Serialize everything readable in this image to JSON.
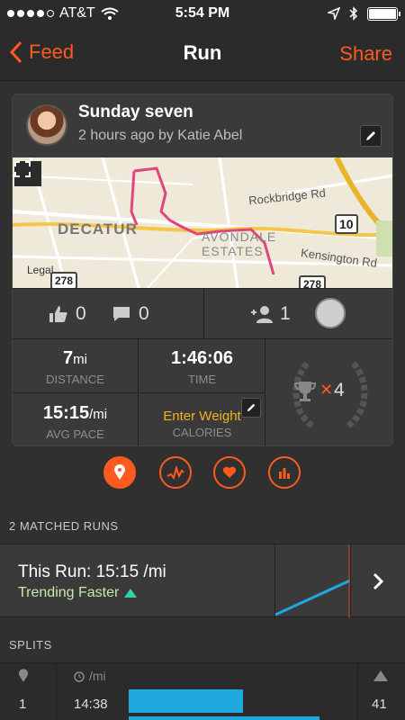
{
  "status": {
    "carrier": "AT&T",
    "time": "5:54 PM",
    "signal_bars": 4,
    "signal_total": 5
  },
  "nav": {
    "back_label": "Feed",
    "title": "Run",
    "share_label": "Share"
  },
  "activity": {
    "title": "Sunday seven",
    "subtitle": "2 hours ago by Katie Abel",
    "map_labels": {
      "decatur": "DECATUR",
      "avondale": "AVONDALE",
      "estates": "ESTATES",
      "rockbridge": "Rockbridge Rd",
      "kensington": "Kensington Rd",
      "legal": "Legal",
      "route_278a": "278",
      "route_278b": "278",
      "route_10": "10"
    }
  },
  "social": {
    "kudos_count": "0",
    "comments_count": "0",
    "athletes_count": "1"
  },
  "stats": {
    "distance_value": "7",
    "distance_unit": "mi",
    "distance_label": "DISTANCE",
    "time_value": "1:46:06",
    "time_label": "TIME",
    "pace_value": "15:15",
    "pace_unit": "/mi",
    "pace_label": "AVG PACE",
    "weight_prompt": "Enter Weight",
    "calories_label": "CALORIES",
    "achievements_count": "4"
  },
  "matched": {
    "section_label": "2 MATCHED RUNS",
    "title": "This Run: 15:15 /mi",
    "trend": "Trending Faster"
  },
  "splits": {
    "section_label": "SPLITS",
    "pace_header": "/mi",
    "rows": [
      {
        "mile": "1",
        "pace": "14:38",
        "elevation": "41",
        "fraction": 0.41
      }
    ]
  },
  "colors": {
    "accent": "#ff5a1f",
    "split_bar": "#1fa8e0",
    "trend_arrow": "#2fd6a0",
    "calories_prompt": "#f3b01c"
  }
}
